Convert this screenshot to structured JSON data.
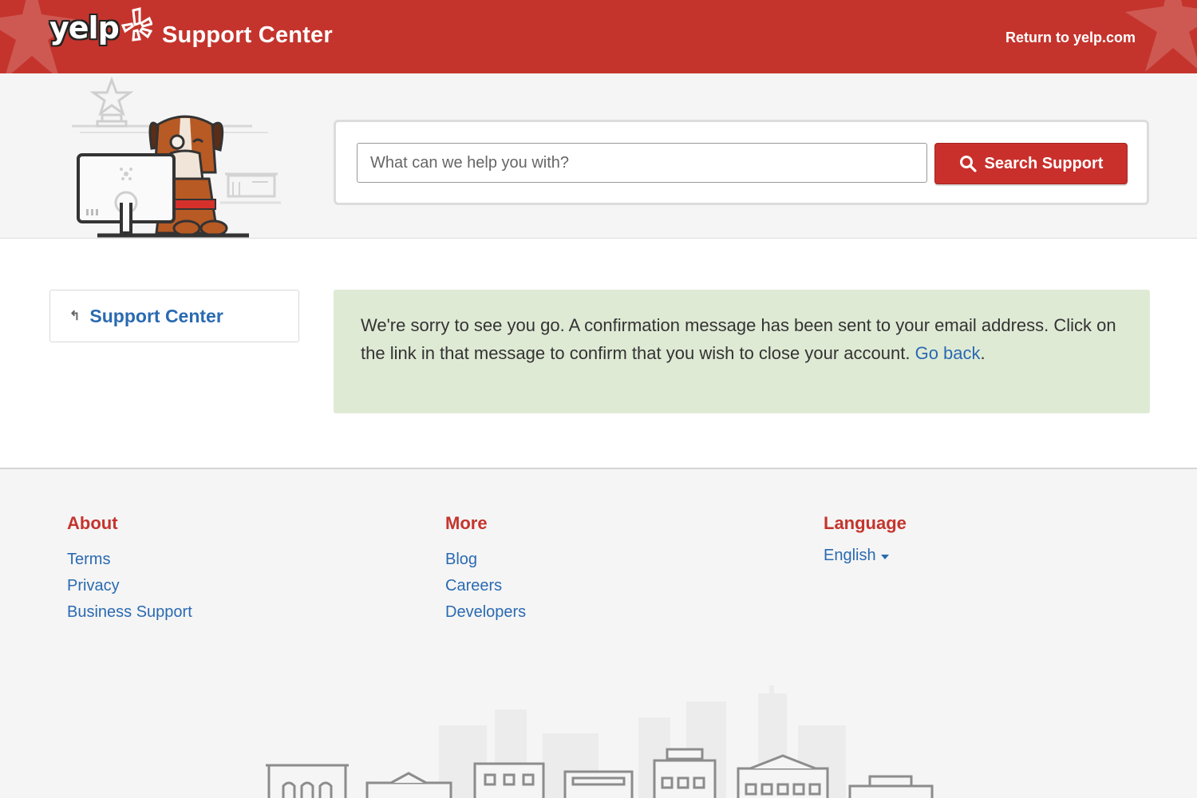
{
  "header": {
    "logo_text": "yelp",
    "title": "Support Center",
    "return_link": "Return to yelp.com",
    "bg_color": "#c4342d"
  },
  "search": {
    "placeholder": "What can we help you with?",
    "value": "",
    "button_label": "Search Support",
    "button_icon": "search-icon"
  },
  "sidebar": {
    "back_link_label": "Support Center",
    "back_link_icon": "return-arrow-icon"
  },
  "notice": {
    "text": "We're sorry to see you go. A confirmation message has been sent to your email address. Click on the link in that message to confirm that you wish to close your account.",
    "link_text": "Go back",
    "trailing": ".",
    "bg_color": "#dfead5"
  },
  "footer": {
    "about": {
      "heading": "About",
      "links": [
        "Terms",
        "Privacy",
        "Business Support"
      ]
    },
    "more": {
      "heading": "More",
      "links": [
        "Blog",
        "Careers",
        "Developers"
      ]
    },
    "language": {
      "heading": "Language",
      "selected": "English"
    },
    "heading_color": "#c4342d",
    "link_color": "#2a6ab1"
  }
}
